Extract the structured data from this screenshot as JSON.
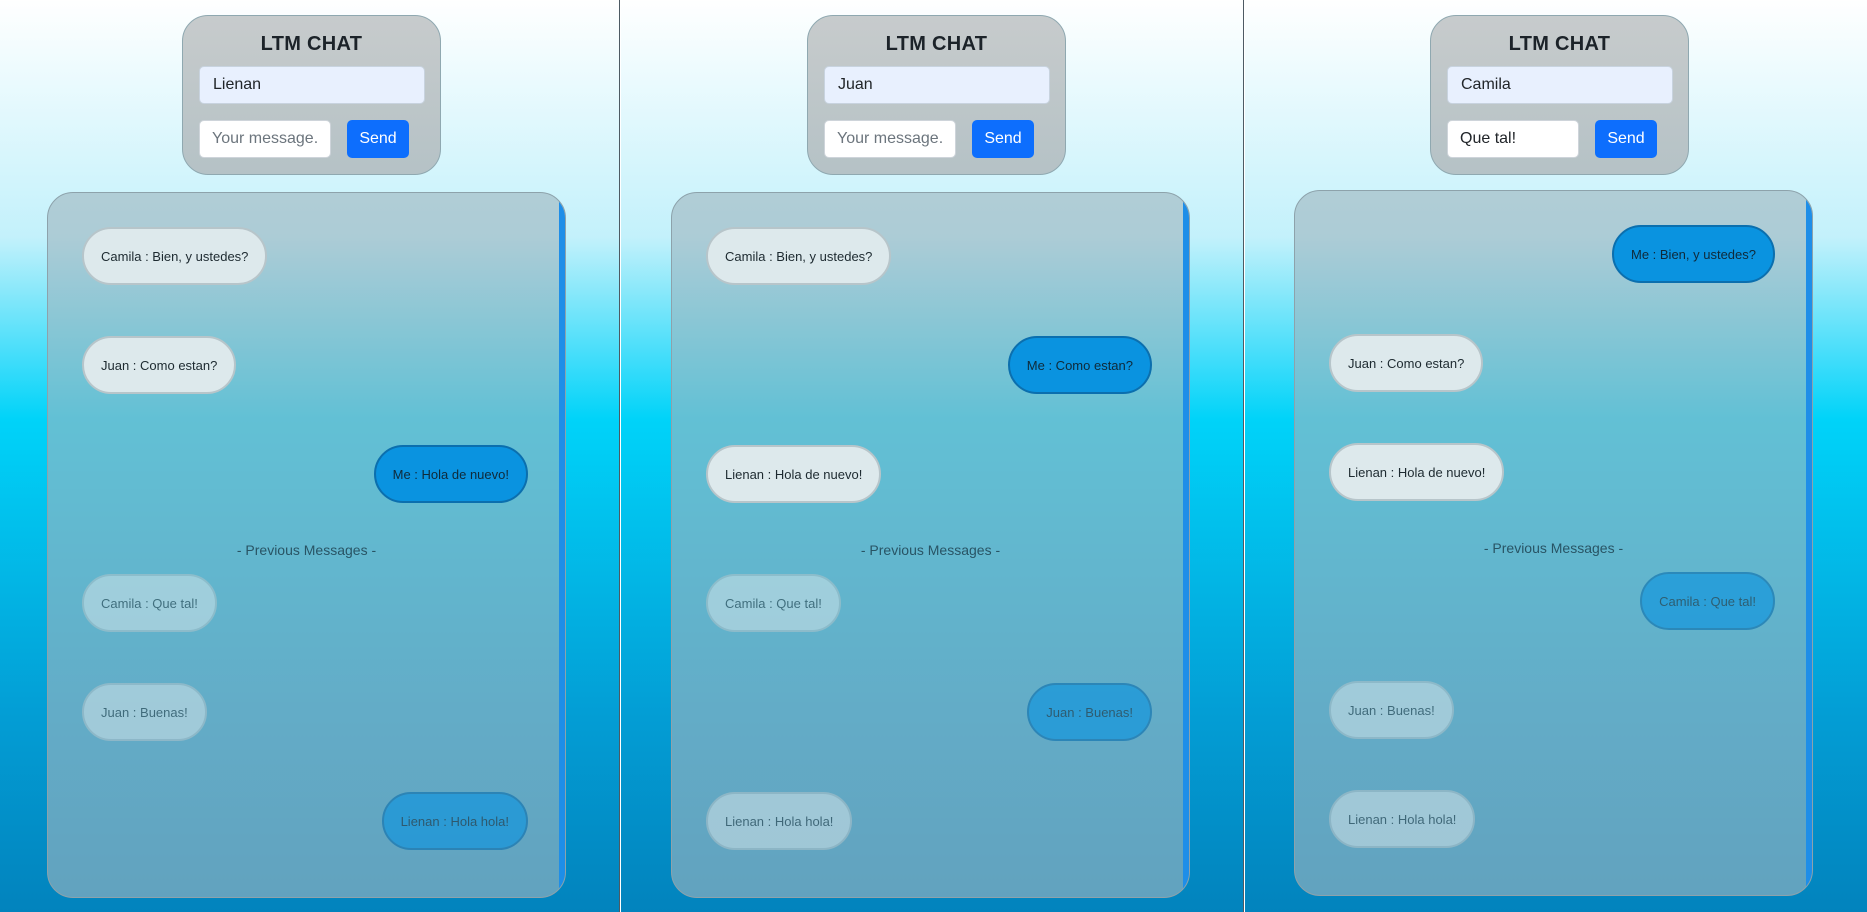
{
  "app": {
    "title": "LTM CHAT",
    "send_label": "Send",
    "message_placeholder": "Your message..",
    "previous_label": "- Previous Messages -"
  },
  "windows": [
    {
      "username": "Lienan",
      "message_value": "",
      "current_messages": [
        {
          "sender": "other",
          "text": "Camila : Bien, y ustedes?"
        },
        {
          "sender": "other",
          "text": "Juan : Como estan?"
        },
        {
          "sender": "me",
          "text": "Me : Hola de nuevo!"
        }
      ],
      "previous_messages": [
        {
          "sender": "other",
          "text": "Camila : Que tal!"
        },
        {
          "sender": "other",
          "text": "Juan : Buenas!"
        },
        {
          "sender": "me",
          "text": "Lienan : Hola hola!"
        }
      ]
    },
    {
      "username": "Juan",
      "message_value": "",
      "current_messages": [
        {
          "sender": "other",
          "text": "Camila : Bien, y ustedes?"
        },
        {
          "sender": "me",
          "text": "Me : Como estan?"
        },
        {
          "sender": "other",
          "text": "Lienan : Hola de nuevo!"
        }
      ],
      "previous_messages": [
        {
          "sender": "other",
          "text": "Camila : Que tal!"
        },
        {
          "sender": "me",
          "text": "Juan : Buenas!"
        },
        {
          "sender": "other",
          "text": "Lienan : Hola hola!"
        }
      ]
    },
    {
      "username": "Camila",
      "message_value": "Que tal!",
      "current_messages": [
        {
          "sender": "me",
          "text": "Me : Bien, y ustedes?"
        },
        {
          "sender": "other",
          "text": "Juan : Como estan?"
        },
        {
          "sender": "other",
          "text": "Lienan : Hola de nuevo!"
        }
      ],
      "previous_messages": [
        {
          "sender": "me",
          "text": "Camila : Que tal!"
        },
        {
          "sender": "other",
          "text": "Juan : Buenas!"
        },
        {
          "sender": "other",
          "text": "Lienan : Hola hola!"
        }
      ]
    }
  ],
  "colors": {
    "send_button": "#0d6efd",
    "own_bubble": "#0a93e0",
    "other_bubble": "#dde9ec",
    "scrollbar": "#1e8ee8"
  }
}
